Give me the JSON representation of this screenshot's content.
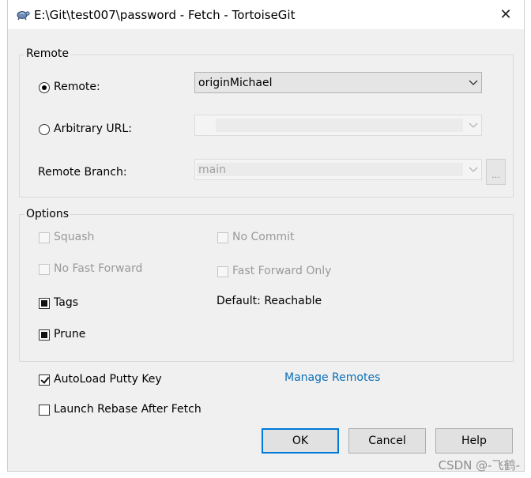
{
  "window": {
    "title": "E:\\Git\\test007\\password - Fetch - TortoiseGit",
    "close_glyph": "✕",
    "icon": "tortoisegit-icon"
  },
  "remote_group": {
    "title": "Remote",
    "remote_label": "Remote:",
    "remote_selected": true,
    "remote_value": "originMichael",
    "arbitrary_label": "Arbitrary URL:",
    "arbitrary_selected": false,
    "arbitrary_value": "",
    "branch_label": "Remote Branch:",
    "branch_value": "main",
    "browse_label": "..."
  },
  "options_group": {
    "title": "Options",
    "squash_label": "Squash",
    "no_commit_label": "No Commit",
    "no_fast_forward_label": "No Fast Forward",
    "fast_forward_only_label": "Fast Forward Only",
    "tags_label": "Tags",
    "default_reachable_label": "Default: Reachable",
    "prune_label": "Prune"
  },
  "autoload_label": "AutoLoad Putty Key",
  "autoload_checked": true,
  "manage_remotes_label": "Manage Remotes",
  "launch_rebase_label": "Launch Rebase After Fetch",
  "launch_rebase_checked": false,
  "buttons": {
    "ok": "OK",
    "cancel": "Cancel",
    "help": "Help"
  },
  "watermark": "CSDN @-飞鹤-",
  "colors": {
    "link": "#0a6fb8",
    "default_button_border": "#0078d7",
    "dialog_bg": "#f0f0f0"
  }
}
